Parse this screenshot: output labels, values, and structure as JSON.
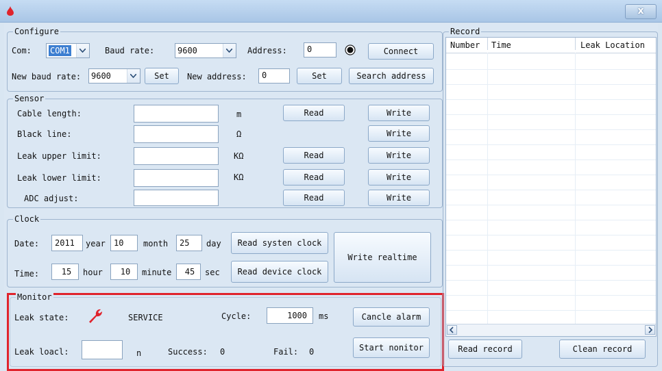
{
  "window": {
    "close_glyph": "x"
  },
  "configure": {
    "title": "Configure",
    "com_label": "Com:",
    "com_value": "COM1",
    "baud_label": "Baud rate:",
    "baud_value": "9600",
    "address_label": "Address:",
    "address_value": "0",
    "connect": "Connect",
    "new_baud_label": "New baud rate:",
    "new_baud_value": "9600",
    "set": "Set",
    "new_address_label": "New address:",
    "new_address_value": "0",
    "set2": "Set",
    "search": "Search address"
  },
  "sensor": {
    "title": "Sensor",
    "rows": [
      {
        "label": "Cable length:",
        "unit": "m",
        "read": "Read",
        "write": "Write"
      },
      {
        "label": "Black line:",
        "unit": "Ω",
        "read": "",
        "write": "Write"
      },
      {
        "label": "Leak upper limit:",
        "unit": "KΩ",
        "read": "Read",
        "write": "Write"
      },
      {
        "label": "Leak lower limit:",
        "unit": "KΩ",
        "read": "Read",
        "write": "Write"
      },
      {
        "label": "ADC adjust:",
        "unit": "",
        "read": "Read",
        "write": "Write"
      }
    ]
  },
  "clock": {
    "title": "Clock",
    "date_label": "Date:",
    "year": "2011",
    "year_label": "year",
    "month": "10",
    "month_label": "month",
    "day": "25",
    "day_label": "day",
    "time_label": "Time:",
    "hour": "15",
    "hour_label": "hour",
    "minute": "10",
    "minute_label": "minute",
    "sec": "45",
    "sec_label": "sec",
    "read_system": "Read systen clock",
    "read_device": "Read device clock",
    "write_realtime": "Write realtime"
  },
  "monitor": {
    "title": "Monitor",
    "leak_state_label": "Leak state:",
    "leak_state_value": "SERVICE",
    "cycle_label": "Cycle:",
    "cycle_value": "1000",
    "cycle_unit": "ms",
    "cancel_alarm": "Cancle alarm",
    "leak_load_label": "Leak loacl:",
    "leak_load_value": "",
    "leak_load_unit": "n",
    "success_label": "Success:",
    "success_value": "0",
    "fail_label": "Fail:",
    "fail_value": "0",
    "start_monitor": "Start nonitor",
    "highlight_color": "#e0232c"
  },
  "record": {
    "title": "Record",
    "columns": [
      "Number",
      "Time",
      "Leak Location"
    ],
    "read_record": "Read record",
    "clean_record": "Clean record"
  }
}
